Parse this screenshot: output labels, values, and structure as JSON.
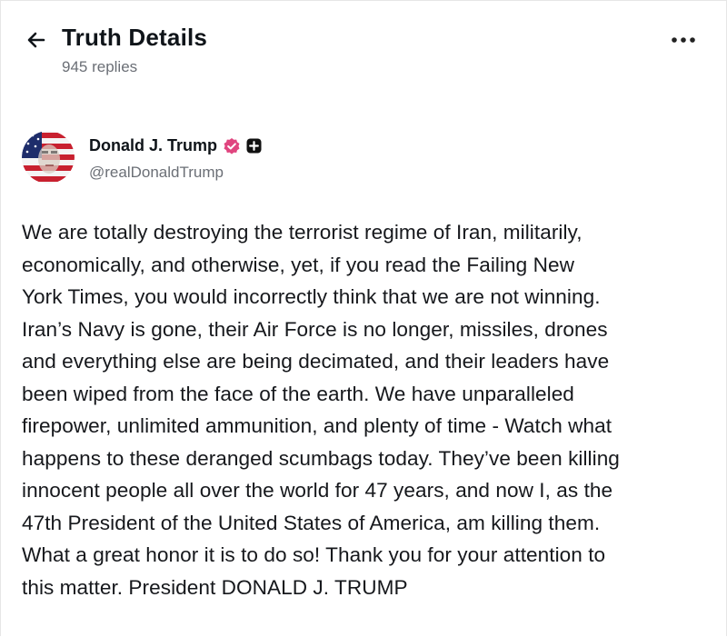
{
  "header": {
    "title": "Truth Details",
    "replies": "945 replies"
  },
  "author": {
    "name": "Donald J. Trump",
    "handle": "@realDonaldTrump"
  },
  "post": {
    "lines": [
      "We are totally destroying the terrorist regime of Iran, militarily,",
      "economically, and otherwise, yet, if you read the Failing New",
      "York Times, you would incorrectly think that we are not winning.",
      "Iran’s Navy is gone, their Air Force is no longer, missiles, drones",
      "and everything else are being decimated, and their leaders have",
      "been wiped from the face of the earth. We have unparalleled",
      "firepower, unlimited ammunition, and plenty of time - Watch what",
      "happens to these deranged scumbags today. They’ve been killing",
      "innocent people all over the world for 47 years, and now I, as the",
      "47th President of the United States of America, am killing them.",
      "What a great honor it is to do so! Thank you for your attention to",
      "this matter. President DONALD J. TRUMP"
    ]
  },
  "icons": {
    "back": "arrow-left-icon",
    "more": "more-horizontal-icon",
    "verified": "verified-badge-icon",
    "plus": "plus-badge-icon"
  },
  "colors": {
    "verified_badge": "#e0457f",
    "text": "#16181c",
    "muted": "#6b6f76"
  }
}
